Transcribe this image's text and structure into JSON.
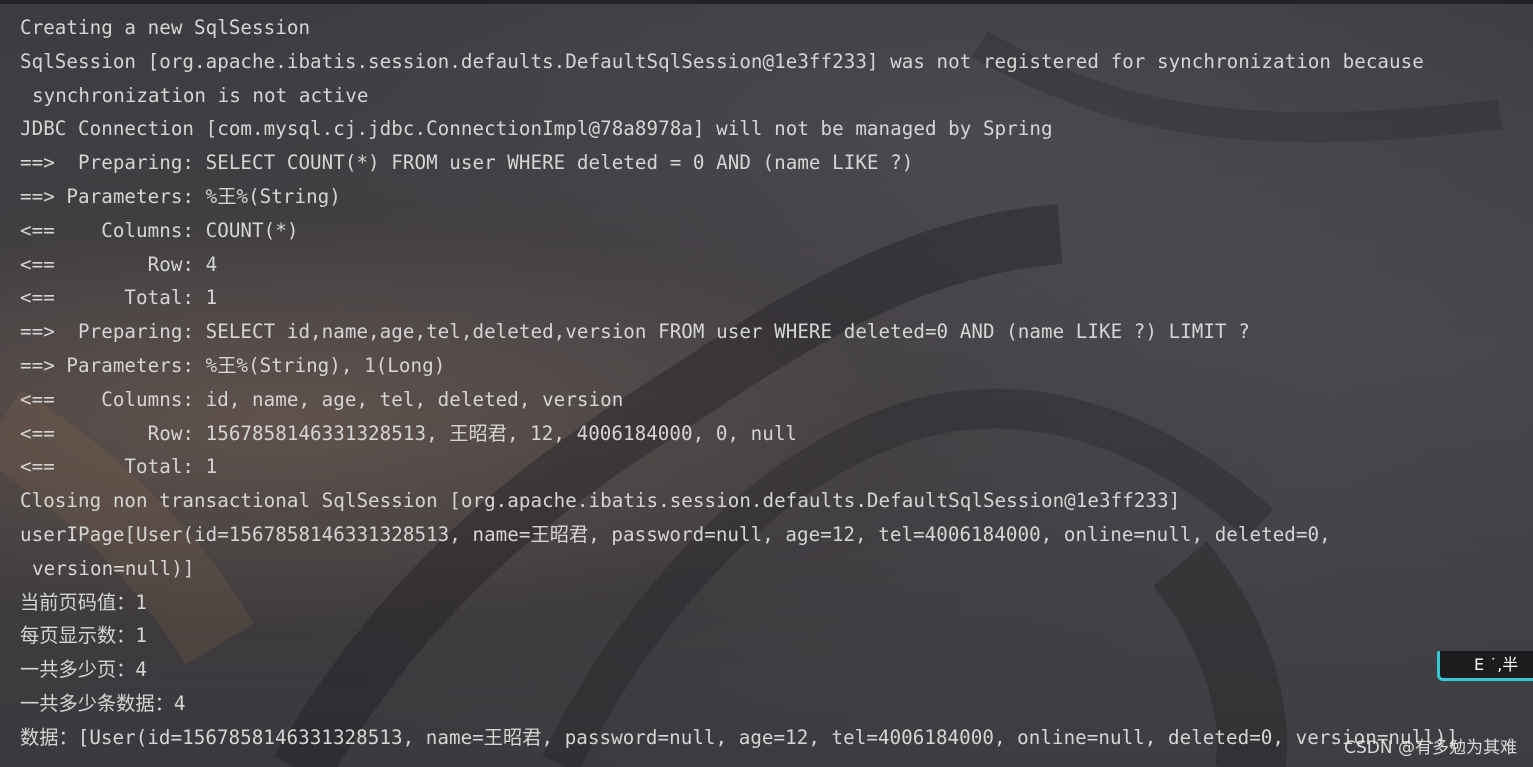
{
  "console": {
    "lines": [
      "Creating a new SqlSession",
      "SqlSession [org.apache.ibatis.session.defaults.DefaultSqlSession@1e3ff233] was not registered for synchronization because",
      "synchronization is not active",
      "JDBC Connection [com.mysql.cj.jdbc.ConnectionImpl@78a8978a] will not be managed by Spring",
      "==>  Preparing: SELECT COUNT(*) FROM user WHERE deleted = 0 AND (name LIKE ?)",
      "==> Parameters: %王%(String)",
      "<==    Columns: COUNT(*)",
      "<==        Row: 4",
      "<==      Total: 1",
      "==>  Preparing: SELECT id,name,age,tel,deleted,version FROM user WHERE deleted=0 AND (name LIKE ?) LIMIT ?",
      "==> Parameters: %王%(String), 1(Long)",
      "<==    Columns: id, name, age, tel, deleted, version",
      "<==        Row: 1567858146331328513, 王昭君, 12, 4006184000, 0, null",
      "<==      Total: 1",
      "Closing non transactional SqlSession [org.apache.ibatis.session.defaults.DefaultSqlSession@1e3ff233]",
      "userIPage[User(id=1567858146331328513, name=王昭君, password=null, age=12, tel=4006184000, online=null, deleted=0,",
      "version=null)]",
      "当前页码值：1",
      "每页显示数：1",
      "一共多少页：4",
      "一共多少条数据：4",
      "数据：[User(id=1567858146331328513, name=王昭君, password=null, age=12, tel=4006184000, online=null, deleted=0, version=null)]"
    ]
  },
  "ime_indicator": {
    "text": "E ˙,半"
  },
  "watermark": {
    "text": "CSDN @有多勉为其难"
  },
  "colors": {
    "text": "#d5d5d5",
    "ime_accent": "#35c9d6"
  }
}
